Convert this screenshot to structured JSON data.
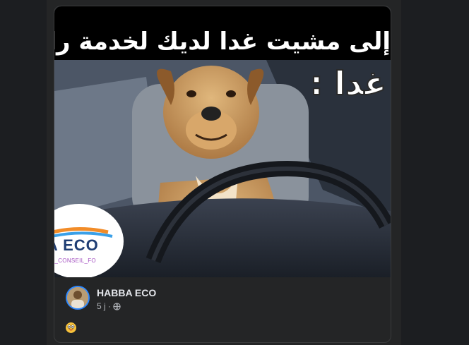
{
  "post": {
    "caption": "إلى مشيت غدا لديك لخدمة راني كلب",
    "overlay_text": "غدا :",
    "logo": {
      "main": "BA ECO",
      "sub": "CIAIRE_CONSEIL_FO"
    },
    "author": "HABBA ECO",
    "time": "5 j ·",
    "privacy_icon": "globe-icon",
    "reaction_icon": "emoji-icon"
  },
  "colors": {
    "background": "#18191a",
    "card": "#242526",
    "text_primary": "#e4e6eb",
    "text_secondary": "#b0b3b8"
  }
}
